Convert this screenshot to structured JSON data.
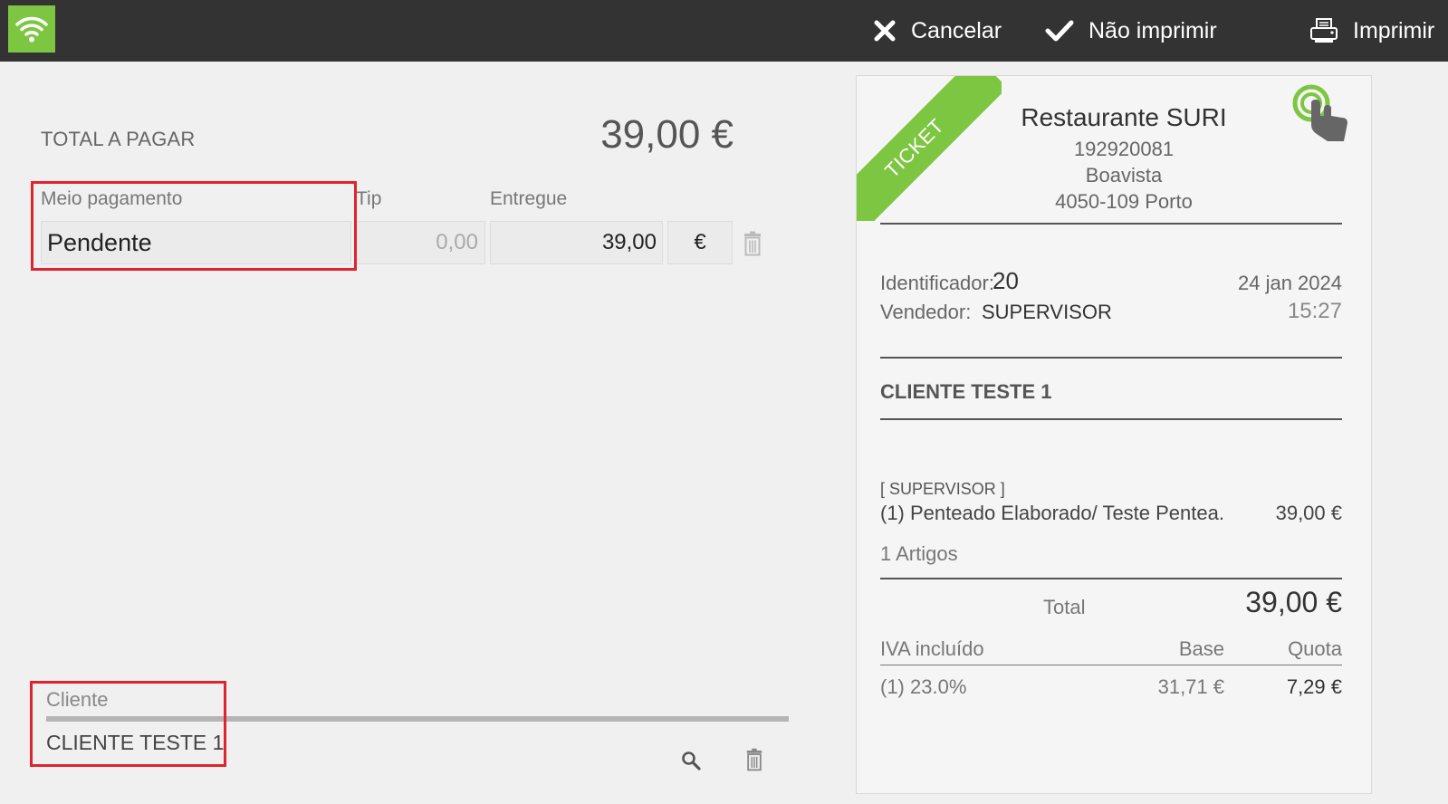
{
  "topbar": {
    "actions": [
      {
        "id": "cancel",
        "label": "Cancelar",
        "icon": "close-icon"
      },
      {
        "id": "noprint",
        "label": "Não imprimir",
        "icon": "check-icon"
      },
      {
        "id": "print",
        "label": "Imprimir",
        "icon": "printer-icon"
      }
    ],
    "wifi_icon": "wifi-icon",
    "wifi_color": "#7dc642"
  },
  "payment": {
    "total_label": "TOTAL A PAGAR",
    "total_value": "39,00 €",
    "columns": {
      "method": "Meio pagamento",
      "tip": "Tip",
      "delivered": "Entregue"
    },
    "row": {
      "method": "Pendente",
      "tip": "0,00",
      "delivered": "39,00",
      "currency": "€"
    }
  },
  "client": {
    "label": "Cliente",
    "value": "CLIENTE TESTE 1"
  },
  "ticket": {
    "ribbon": "TICKET",
    "store_name": "Restaurante SURI",
    "nif": "192920081",
    "street": "Boavista",
    "city": "4050-109 Porto",
    "id_label": "Identificador:",
    "id_value": "20",
    "seller_label": "Vendedor:",
    "seller_value": "SUPERVISOR",
    "date": "24 jan 2024",
    "time": "15:27",
    "customer": "CLIENTE TESTE 1",
    "seller_tag": "[ SUPERVISOR ]",
    "line_item": "(1) Penteado Elaborado/ Teste Pentea...",
    "line_price": "39,00 €",
    "items_count": "1 Artigos",
    "total_label": "Total",
    "total_value": "39,00 €",
    "vat_header": {
      "label": "IVA incluído",
      "base": "Base",
      "quota": "Quota"
    },
    "vat_row": {
      "rate": "(1) 23.0%",
      "base": "31,71 €",
      "quota": "7,29 €"
    }
  },
  "colors": {
    "topbar": "#333333",
    "accent_green": "#7dc642",
    "highlight_red": "#e0242e"
  }
}
